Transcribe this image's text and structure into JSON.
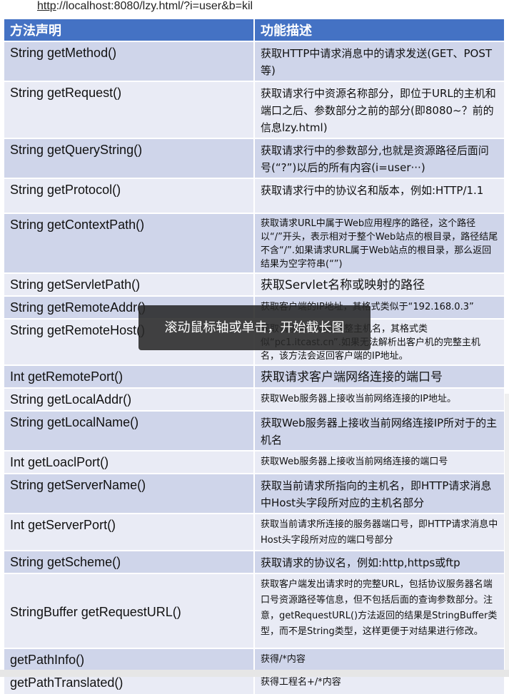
{
  "url": {
    "scheme": "http",
    "rest": "://localhost:8080/lzy.html/?i=user&b=kil"
  },
  "headers": {
    "method": "方法声明",
    "description": "功能描述"
  },
  "rows": [
    {
      "method": "String getMethod()",
      "desc": "获取HTTP中请求消息中的请求发送(GET、POST等)"
    },
    {
      "method": "String getRequest()",
      "desc": "获取请求行中资源名称部分，即位于URL的主机和端口之后、参数部分之前的部分(即8080~？前的信息lzy.html)"
    },
    {
      "method": "String getQueryString()",
      "desc": "获取请求行中的参数部分,也就是资源路径后面问号(“?”)以后的所有内容(i=user···)"
    },
    {
      "method": "String getProtocol()",
      "desc": "获取请求行中的协议名和版本，例如:HTTP/1.1"
    },
    {
      "method": "String getContextPath()",
      "desc": "获取请求URL中属于Web应用程序的路径，这个路径以“/”开头，表示相对于整个Web站点的根目录，路径结尾不含“/”.如果请求URL属于Web站点的根目录，那么返回结果为空字符串(“”)"
    },
    {
      "method": "String getServletPath()",
      "desc": "获取Servlet名称或映射的路径"
    },
    {
      "method": "String getRemoteAddr()",
      "desc": "获取客户端的IP地址，其格式类似于“192.168.0.3”"
    },
    {
      "method": "String getRemoteHost()",
      "desc": "获取请求客户端的完整主机名，其格式类似“pc1.itcast.cn”.如果无法解析出客户机的完整主机名，该方法会返回客户端的IP地址。"
    },
    {
      "method": "Int getRemotePort()",
      "desc": "获取请求客户端网络连接的端口号"
    },
    {
      "method": "String getLocalAddr()",
      "desc": "获取Web服务器上接收当前网络连接的IP地址。"
    },
    {
      "method": "String getLocalName()",
      "desc": "获取Web服务器上接收当前网络连接IP所对于的主机名"
    },
    {
      "method": "Int getLoaclPort()",
      "desc": "获取Web服务器上接收当前网络连接的端口号"
    },
    {
      "method": "String getServerName()",
      "desc": "获取当前请求所指向的主机名，即HTTP请求消息中Host头字段所对应的主机名部分"
    },
    {
      "method": "Int getServerPort()",
      "desc": "获取当前请求所连接的服务器端口号，即HTTP请求消息中Host头字段所对应的端口号部分"
    },
    {
      "method": "String getScheme()",
      "desc": "获取请求的协议名，例如:http,https或ftp"
    },
    {
      "method": "StringBuffer getRequestURL()",
      "desc": "获取客户端发出请求时的完整URL，包括协议服务器名端口号资源路径等信息，但不包括后面的查询参数部分。注意，getRequestURL()方法返回的结果是StringBuffer类型，而不是String类型，这样更便于对结果进行修改。"
    },
    {
      "method": "getPathInfo()",
      "desc": "获得/*内容"
    },
    {
      "method": "getPathTranslated()",
      "desc": "获得工程名+/*内容"
    }
  ],
  "toast": "滚动鼠标轴或单击，开始截长图",
  "colors": {
    "header": "#4472c4",
    "row_dark": "#cfd5ea",
    "row_light": "#e9ebf5",
    "toast_bg": "#282828"
  }
}
